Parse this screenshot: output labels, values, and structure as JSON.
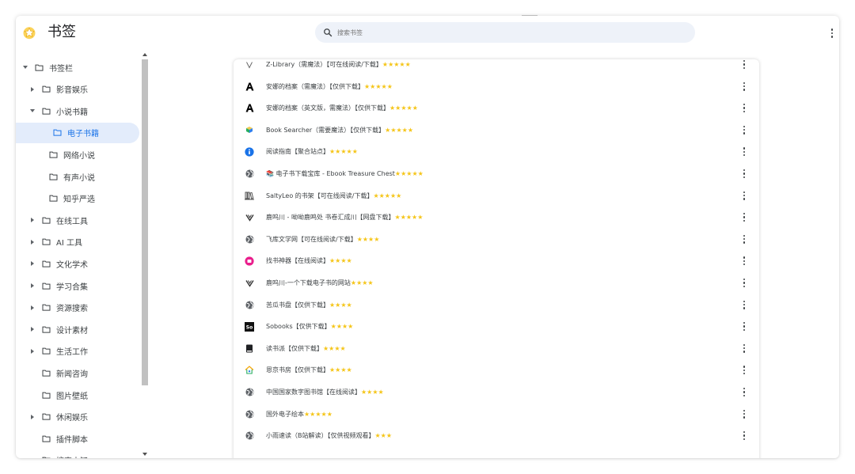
{
  "app": {
    "title": "书签"
  },
  "search": {
    "placeholder": "搜索书签"
  },
  "sidebar": {
    "items": [
      {
        "label": "书签栏",
        "level": 0,
        "arrow": "down"
      },
      {
        "label": "影音娱乐",
        "level": 1,
        "arrow": "right"
      },
      {
        "label": "小说书籍",
        "level": 1,
        "arrow": "down"
      },
      {
        "label": "电子书籍",
        "level": 2,
        "arrow": "none",
        "selected": true
      },
      {
        "label": "网络小说",
        "level": 2,
        "arrow": "none"
      },
      {
        "label": "有声小说",
        "level": 2,
        "arrow": "none"
      },
      {
        "label": "知乎严选",
        "level": 2,
        "arrow": "none"
      },
      {
        "label": "在线工具",
        "level": 1,
        "arrow": "right"
      },
      {
        "label": "AI 工具",
        "level": 1,
        "arrow": "right"
      },
      {
        "label": "文化学术",
        "level": 1,
        "arrow": "right"
      },
      {
        "label": "学习合集",
        "level": 1,
        "arrow": "right"
      },
      {
        "label": "资源搜索",
        "level": 1,
        "arrow": "right"
      },
      {
        "label": "设计素材",
        "level": 1,
        "arrow": "right"
      },
      {
        "label": "生活工作",
        "level": 1,
        "arrow": "right"
      },
      {
        "label": "新闻咨询",
        "level": 1,
        "arrow": "none"
      },
      {
        "label": "图片壁纸",
        "level": 1,
        "arrow": "none"
      },
      {
        "label": "休闲娱乐",
        "level": 1,
        "arrow": "right"
      },
      {
        "label": "插件脚本",
        "level": 1,
        "arrow": "none"
      },
      {
        "label": "搜索未知",
        "level": 1,
        "arrow": "none"
      }
    ]
  },
  "bookmarks": [
    {
      "title": "Z-Library（需魔法）【可在线阅读/下载】",
      "stars": "★★★★★",
      "icon": "zlib-icon"
    },
    {
      "title": "安娜的档案（需魔法）【仅供下载】",
      "stars": "★★★★★",
      "icon": "annas-archive-icon"
    },
    {
      "title": "安娜的档案（英文版，需魔法）【仅供下载】",
      "stars": "★★★★★",
      "icon": "annas-archive-icon"
    },
    {
      "title": "Book Searcher（需要魔法）【仅供下载】",
      "stars": "★★★★★",
      "icon": "book-searcher-icon"
    },
    {
      "title": "阅读指南【聚合站点】",
      "stars": "★★★★★",
      "icon": "reading-guide-icon"
    },
    {
      "title": "📚 电子书下载宝库 - Ebook Treasure Chest",
      "stars": "★★★★★",
      "icon": "globe-icon"
    },
    {
      "title": "SaltyLeo 的书架【可在线阅读/下载】",
      "stars": "★★★★★",
      "icon": "bookshelf-icon"
    },
    {
      "title": "鹿呜川 - 呦呦鹿鸣处 书卷汇成川【网盘下载】",
      "stars": "★★★★★",
      "icon": "luming-icon"
    },
    {
      "title": "飞库文学网【可在线阅读/下载】",
      "stars": "★★★★",
      "icon": "globe-icon"
    },
    {
      "title": "找书神器【在线阅读】",
      "stars": "★★★★",
      "icon": "book-finder-icon"
    },
    {
      "title": "鹿呜川-一个下载电子书的网站",
      "stars": "★★★★",
      "icon": "luming-icon"
    },
    {
      "title": "苦瓜书盘【仅供下载】",
      "stars": "★★★★",
      "icon": "globe-icon"
    },
    {
      "title": "Sobooks【仅供下载】",
      "stars": "★★★★",
      "icon": "sobooks-icon"
    },
    {
      "title": "读书派【仅供下载】",
      "stars": "★★★★",
      "icon": "dushupai-icon"
    },
    {
      "title": "恩京书房【仅供下载】",
      "stars": "★★★★",
      "icon": "house-icon"
    },
    {
      "title": "中国国家数字图书馆【在线阅读】",
      "stars": "★★★★",
      "icon": "globe-icon"
    },
    {
      "title": "国外电子绘本",
      "stars": "★★★★★",
      "icon": "globe-icon"
    },
    {
      "title": "小雨速读（B站解读）【仅供视频观看】",
      "stars": "★★★",
      "icon": "globe-icon"
    }
  ],
  "colors": {
    "accent": "#1a73e8",
    "selected_bg": "#e3ecfb",
    "star": "#f5c518",
    "search_bg": "#eef2f9"
  }
}
